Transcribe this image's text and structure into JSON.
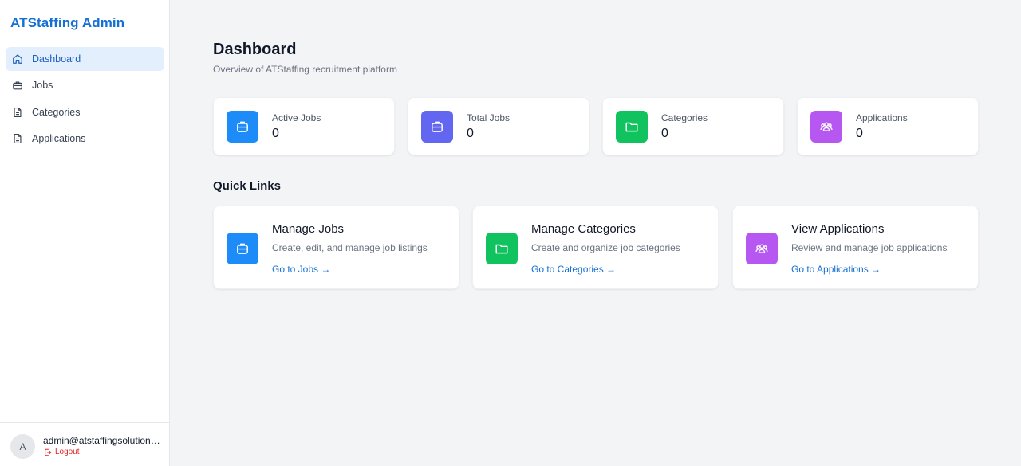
{
  "sidebar": {
    "brand": "ATStaffing Admin",
    "items": [
      {
        "label": "Dashboard",
        "icon": "home-icon",
        "active": true
      },
      {
        "label": "Jobs",
        "icon": "briefcase-icon"
      },
      {
        "label": "Categories",
        "icon": "document-icon"
      },
      {
        "label": "Applications",
        "icon": "document-icon"
      }
    ],
    "user": {
      "avatar_initial": "A",
      "email": "admin@atstaffingsolutions.com",
      "logout_label": "Logout"
    }
  },
  "header": {
    "title": "Dashboard",
    "subtitle": "Overview of ATStaffing recruitment platform"
  },
  "stats": [
    {
      "label": "Active Jobs",
      "value": "0",
      "icon": "briefcase-icon",
      "color": "#1d8cf8"
    },
    {
      "label": "Total Jobs",
      "value": "0",
      "icon": "briefcase-icon",
      "color": "#6366f1"
    },
    {
      "label": "Categories",
      "value": "0",
      "icon": "folder-icon",
      "color": "#10c35f"
    },
    {
      "label": "Applications",
      "value": "0",
      "icon": "users-icon",
      "color": "#b657f2"
    }
  ],
  "quick_links": {
    "title": "Quick Links",
    "cards": [
      {
        "title": "Manage Jobs",
        "description": "Create, edit, and manage job listings",
        "link": "Go to Jobs →",
        "icon": "briefcase-icon",
        "color": "#1d8cf8"
      },
      {
        "title": "Manage Categories",
        "description": "Create and organize job categories",
        "link": "Go to Categories →",
        "icon": "folder-icon",
        "color": "#10c35f"
      },
      {
        "title": "View Applications",
        "description": "Review and manage job applications",
        "link": "Go to Applications →",
        "icon": "users-icon",
        "color": "#b657f2"
      }
    ]
  },
  "colors": {
    "accent": "#1570d4",
    "active_nav_bg": "#e3effd",
    "logout": "#dc2626"
  }
}
